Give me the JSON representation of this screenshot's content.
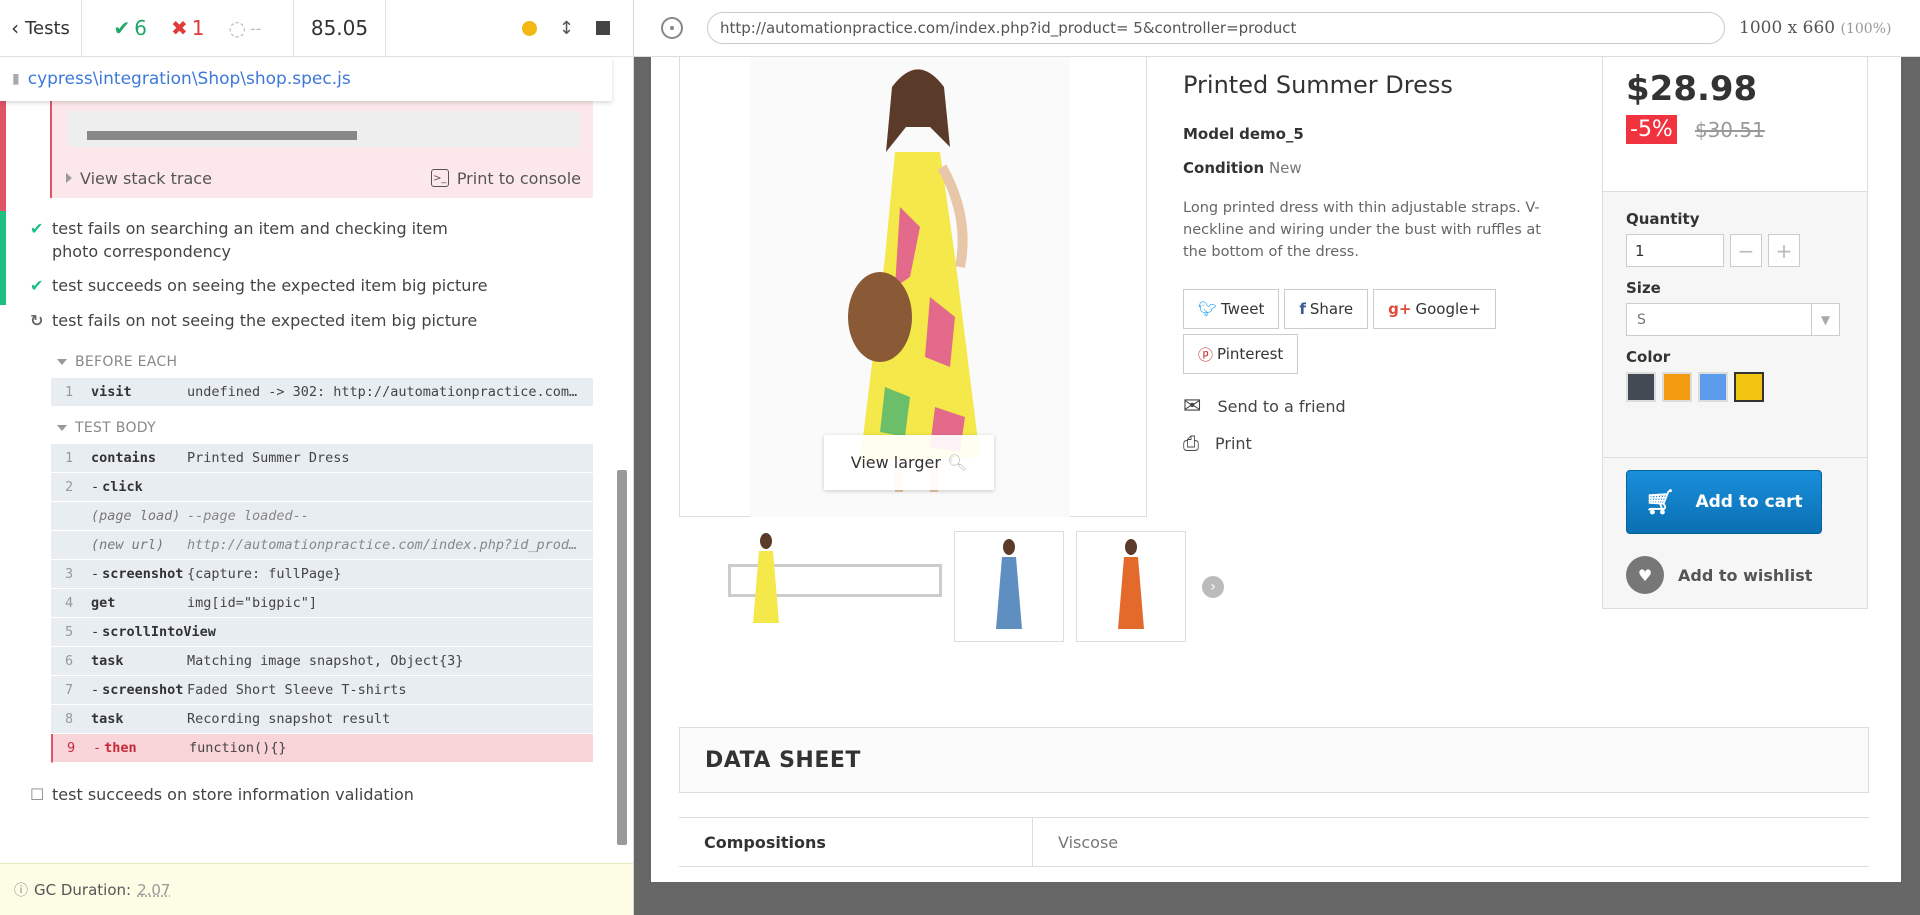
{
  "runner": {
    "back_label": "Tests",
    "passed": "6",
    "failed": "1",
    "pending": "--",
    "duration": "85.05",
    "spec_path": "cypress\\integration\\Shop\\shop.spec.js",
    "view_stack_trace": "View stack trace",
    "print_to_console": "Print to console",
    "tests": [
      {
        "state": "passed",
        "title": "test fails on searching an item and checking item photo correspondency"
      },
      {
        "state": "passed",
        "title": "test succeeds on seeing the expected item big picture"
      },
      {
        "state": "running",
        "title": "test fails on not seeing the expected item big picture"
      },
      {
        "state": "pending",
        "title": "test succeeds on store information validation"
      }
    ],
    "before_each_label": "BEFORE EACH",
    "before_each_cmds": [
      {
        "num": "1",
        "name": "visit",
        "msg": "undefined -> 302: http://automationpractice.com/…"
      }
    ],
    "test_body_label": "TEST BODY",
    "test_body_cmds": [
      {
        "num": "1",
        "name": "contains",
        "msg": "Printed Summer Dress"
      },
      {
        "num": "2",
        "name": "click",
        "msg": ""
      },
      {
        "num": "",
        "name": "(page load)",
        "msg": "--page loaded--"
      },
      {
        "num": "",
        "name": "(new url)",
        "msg": "http://automationpractice.com/index.php?id_produ…"
      },
      {
        "num": "3",
        "name": "screenshot",
        "msg": "{capture: fullPage}"
      },
      {
        "num": "4",
        "name": "get",
        "msg": "img[id=\"bigpic\"]"
      },
      {
        "num": "5",
        "name": "scrollIntoView",
        "msg": ""
      },
      {
        "num": "6",
        "name": "task",
        "msg": "Matching image snapshot, Object{3}"
      },
      {
        "num": "7",
        "name": "screenshot",
        "msg": "Faded Short Sleeve T-shirts"
      },
      {
        "num": "8",
        "name": "task",
        "msg": "Recording snapshot result"
      },
      {
        "num": "9",
        "name": "then",
        "msg": "function(){}"
      }
    ],
    "gc_label": "GC Duration:",
    "gc_value": "2.07"
  },
  "aut": {
    "url": "http://automationpractice.com/index.php?id_product= 5&controller=product",
    "viewport": "1000 x 660",
    "viewport_pct": "(100%)",
    "product": {
      "title": "Printed Summer Dress",
      "model_label": "Model",
      "model": "demo_5",
      "condition_label": "Condition",
      "condition": "New",
      "description": "Long printed dress with thin adjustable straps. V-neckline and wiring under the bust with ruffles at the bottom of the dress.",
      "view_larger": "View larger",
      "share": [
        "Tweet",
        "Share",
        "Google+",
        "Pinterest"
      ],
      "send_friend": "Send to a friend",
      "print": "Print",
      "price": "$28.98",
      "discount": "-5%",
      "old_price": "$30.51",
      "quantity_label": "Quantity",
      "quantity": "1",
      "size_label": "Size",
      "size": "S",
      "color_label": "Color",
      "colors": [
        "#434a54",
        "#f39c11",
        "#5d9cec",
        "#f1c40f"
      ],
      "add_to_cart": "Add to cart",
      "add_to_wishlist": "Add to wishlist",
      "data_sheet": "DATA SHEET",
      "sheet_key": "Compositions",
      "sheet_value": "Viscose"
    }
  }
}
